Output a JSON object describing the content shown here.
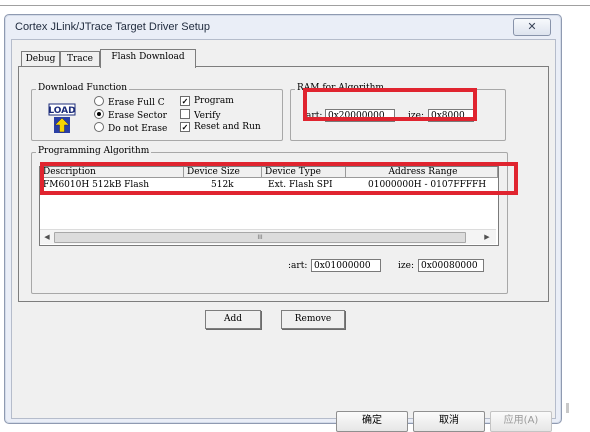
{
  "window": {
    "title": "Cortex JLink/JTrace Target Driver Setup",
    "close_glyph": "✕"
  },
  "tabs": [
    {
      "label": "Debug",
      "active": false
    },
    {
      "label": "Trace",
      "active": false
    },
    {
      "label": "Flash Download",
      "active": true
    }
  ],
  "download_function": {
    "group_label": "Download Function",
    "icon_text": "LOAD",
    "radios": [
      {
        "label": "Erase Full C",
        "selected": false
      },
      {
        "label": "Erase Sector",
        "selected": true
      },
      {
        "label": "Do not Erase",
        "selected": false
      }
    ],
    "checkboxes": [
      {
        "label": "Program",
        "checked": true
      },
      {
        "label": "Verify",
        "checked": false
      },
      {
        "label": "Reset and Run",
        "checked": true
      }
    ],
    "check_glyph": "✓"
  },
  "ram_for_algorithm": {
    "group_label": "RAM for Algorithm",
    "start_label": ":art:",
    "start_value": "0x20000000",
    "size_label": "ize:",
    "size_value": "0x8000"
  },
  "programming_algorithm": {
    "group_label": "Programming Algorithm",
    "columns": [
      "Description",
      "Device Size",
      "Device Type",
      "Address Range"
    ],
    "rows": [
      {
        "description": "FM6010H 512kB Flash",
        "device_size": "512k",
        "device_type": "Ext. Flash SPI",
        "address_range": "01000000H - 0107FFFFH"
      }
    ],
    "scroll_left": "◀",
    "scroll_right": "▶",
    "scroll_thumb_grip": "III",
    "start_label": ":art:",
    "start_value": "0x01000000",
    "size_label": "ize:",
    "size_value": "0x00080000"
  },
  "panel_buttons": {
    "add": "Add",
    "remove": "Remove"
  },
  "dialog_buttons": {
    "ok": "确定",
    "cancel": "取消",
    "apply": "应用(A)"
  },
  "colors": {
    "highlight_box": "#e0242f",
    "window_frame": "#eaeef7",
    "dialog_face": "#f0f0f0"
  }
}
